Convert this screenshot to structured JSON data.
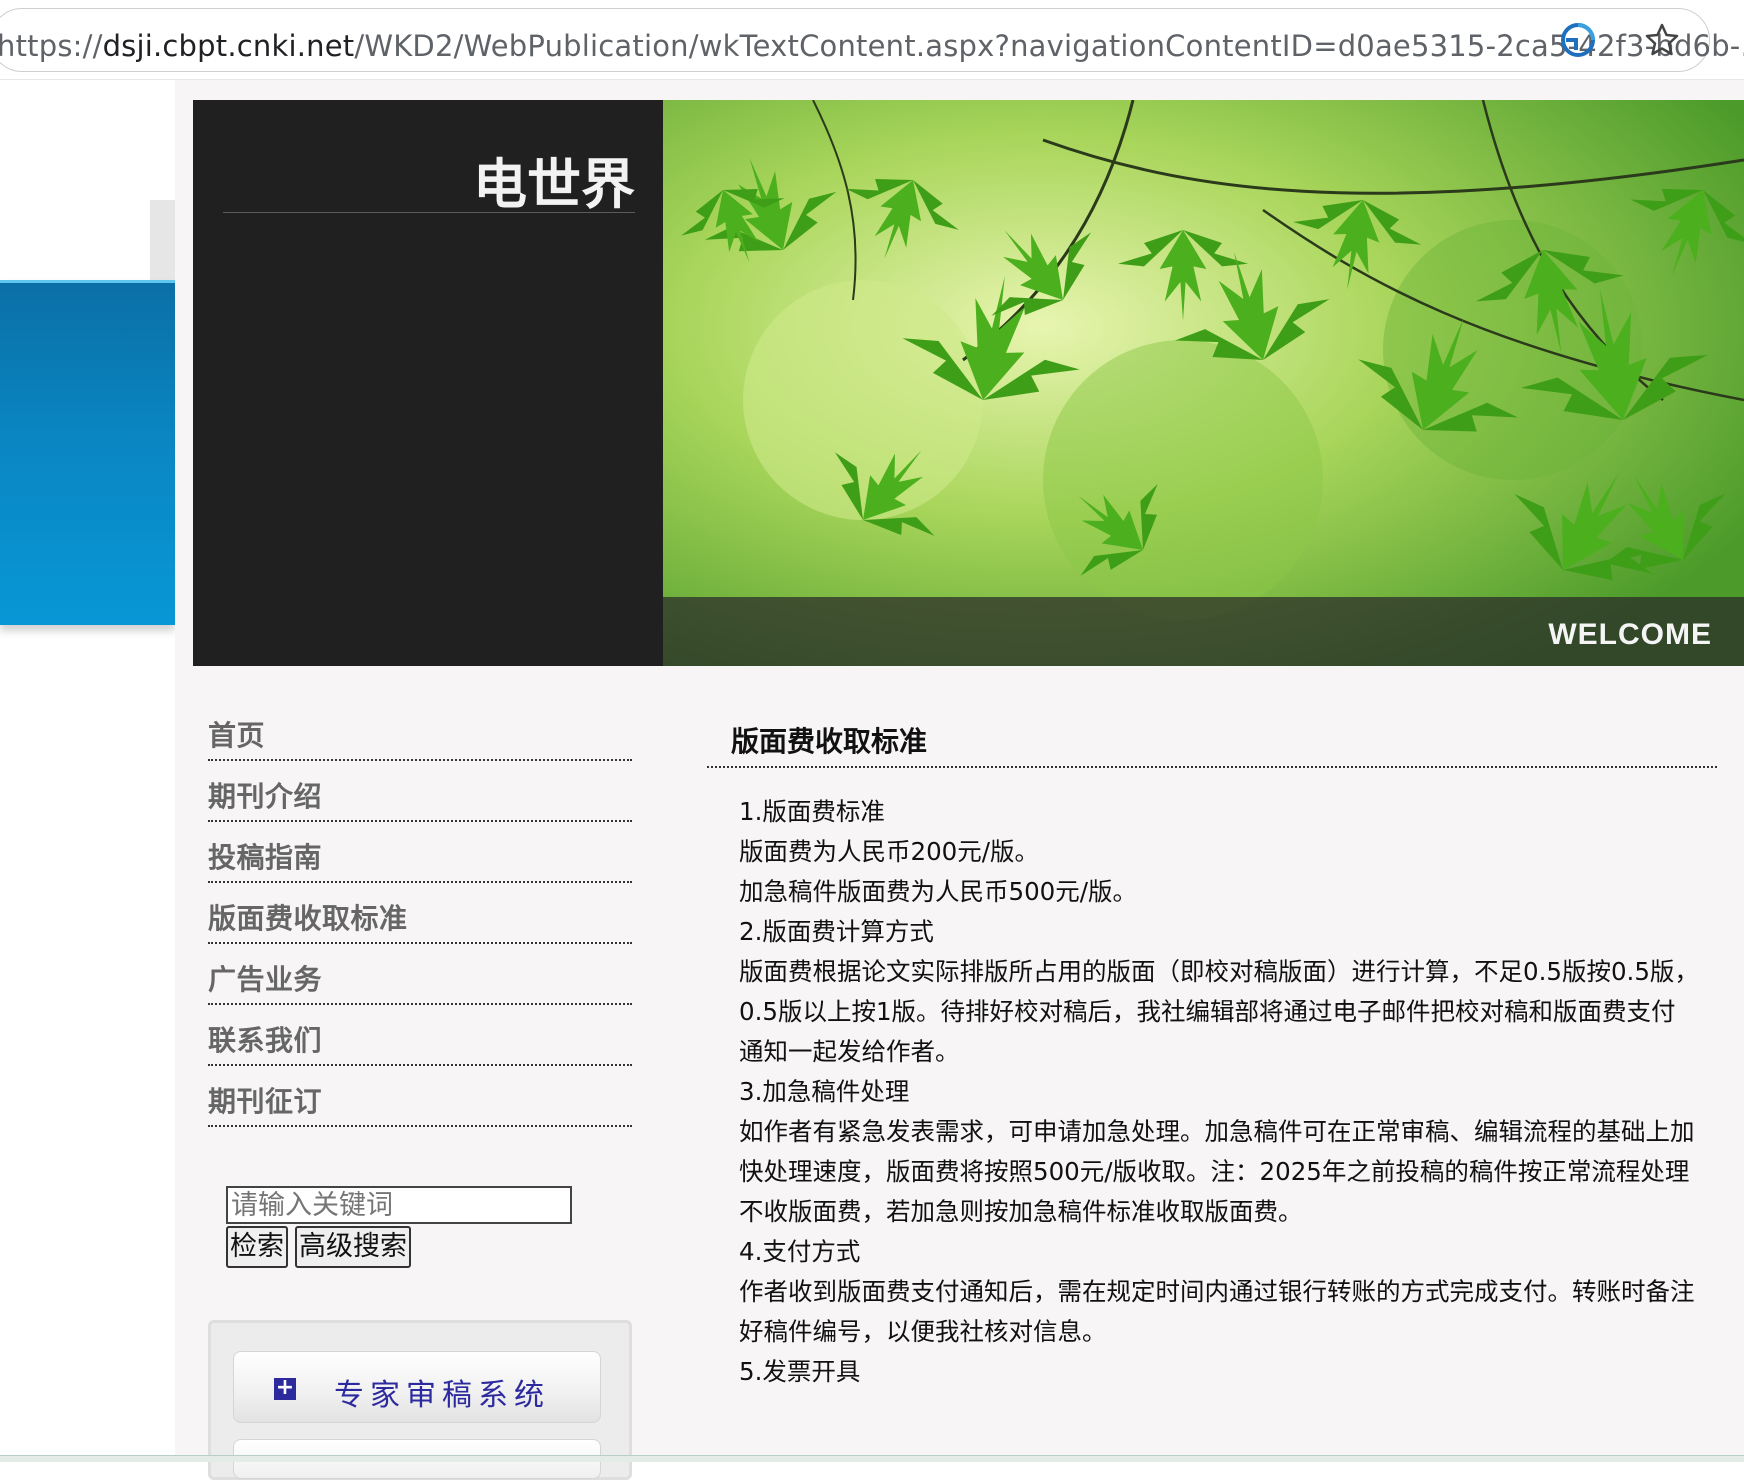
{
  "browser": {
    "url_prefix": "https://",
    "url_host": "dsji.cbpt.cnki.net",
    "url_path": "/WKD2/WebPublication/wkTextContent.aspx?navigationContentID=d0ae5315-2ca5-42f3-bd6b-..."
  },
  "header": {
    "site_title": "电世界",
    "banner_caption": "WELCOME"
  },
  "nav": {
    "items": [
      "首页",
      "期刊介绍",
      "投稿指南",
      "版面费收取标准",
      "广告业务",
      "联系我们",
      "期刊征订"
    ]
  },
  "search": {
    "placeholder": "请输入关键词",
    "search_label": "检索",
    "advanced_label": "高级搜索"
  },
  "sidebar": {
    "expert_label": "专家审稿系统"
  },
  "article": {
    "title": "版面费收取标准",
    "paragraphs": [
      "1.版面费标准",
      "版面费为人民币200元/版。",
      "加急稿件版面费为人民币500元/版。",
      "2.版面费计算方式",
      "版面费根据论文实际排版所占用的版面（即校对稿版面）进行计算，不足0.5版按0.5版，0.5版以上按1版。待排好校对稿后，我社编辑部将通过电子邮件把校对稿和版面费支付通知一起发给作者。",
      "3.加急稿件处理",
      "如作者有紧急发表需求，可申请加急处理。加急稿件可在正常审稿、编辑流程的基础上加快处理速度，版面费将按照500元/版收取。注：2025年之前投稿的稿件按正常流程处理不收版面费，若加急则按加急稿件标准收取版面费。",
      "4.支付方式",
      "作者收到版面费支付通知后，需在规定时间内通过银行转账的方式完成支付。转账时备注好稿件编号，以便我社核对信息。",
      "5.发票开具"
    ]
  },
  "colors": {
    "header_bg": "#202020",
    "page_bg": "#f7f5f5",
    "nav_text": "#666666",
    "expert_text": "#2d2a9e"
  }
}
